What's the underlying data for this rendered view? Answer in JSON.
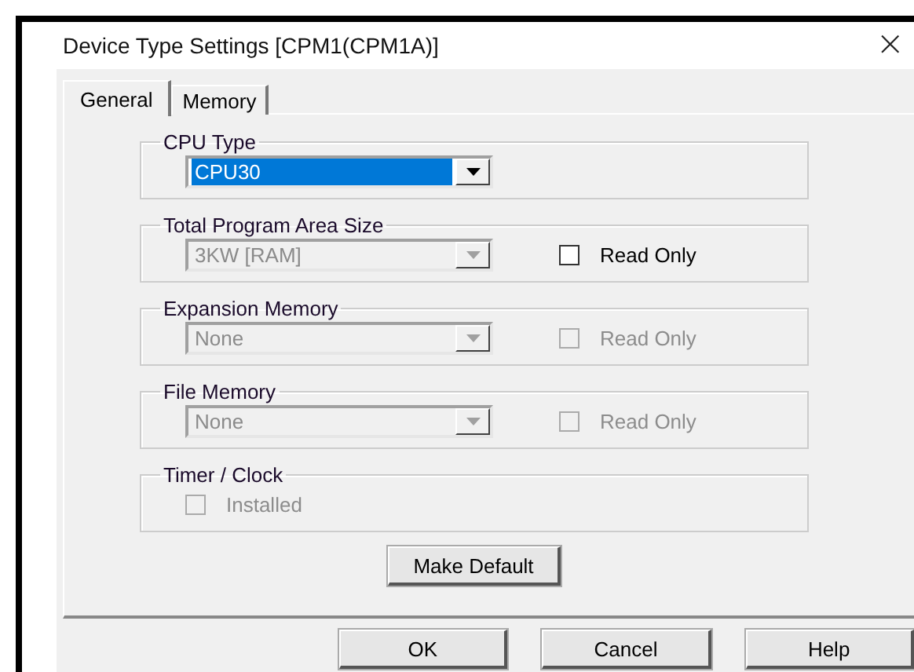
{
  "window": {
    "title": "Device Type Settings [CPM1(CPM1A)]",
    "close": "×"
  },
  "tabs": [
    {
      "label": "General",
      "selected": true
    },
    {
      "label": "Memory",
      "selected": false
    }
  ],
  "groups": [
    {
      "title": "CPU Type",
      "combo": {
        "value": "CPU30",
        "disabled": false,
        "selected": true
      }
    },
    {
      "title": "Total Program Area Size",
      "combo": {
        "value": "3KW [RAM]",
        "disabled": true,
        "selected": false
      },
      "checkbox": {
        "label": "Read Only",
        "checked": false,
        "disabled": false
      }
    },
    {
      "title": "Expansion Memory",
      "combo": {
        "value": "None",
        "disabled": true,
        "selected": false
      },
      "checkbox": {
        "label": "Read Only",
        "checked": false,
        "disabled": true
      }
    },
    {
      "title": "File Memory",
      "combo": {
        "value": "None",
        "disabled": true,
        "selected": false
      },
      "checkbox": {
        "label": "Read Only",
        "checked": false,
        "disabled": true
      }
    },
    {
      "title": "Timer / Clock",
      "checkbox": {
        "label": "Installed",
        "checked": false,
        "disabled": true
      }
    }
  ],
  "panel_button": "Make Default",
  "buttons": [
    "OK",
    "Cancel",
    "Help"
  ]
}
